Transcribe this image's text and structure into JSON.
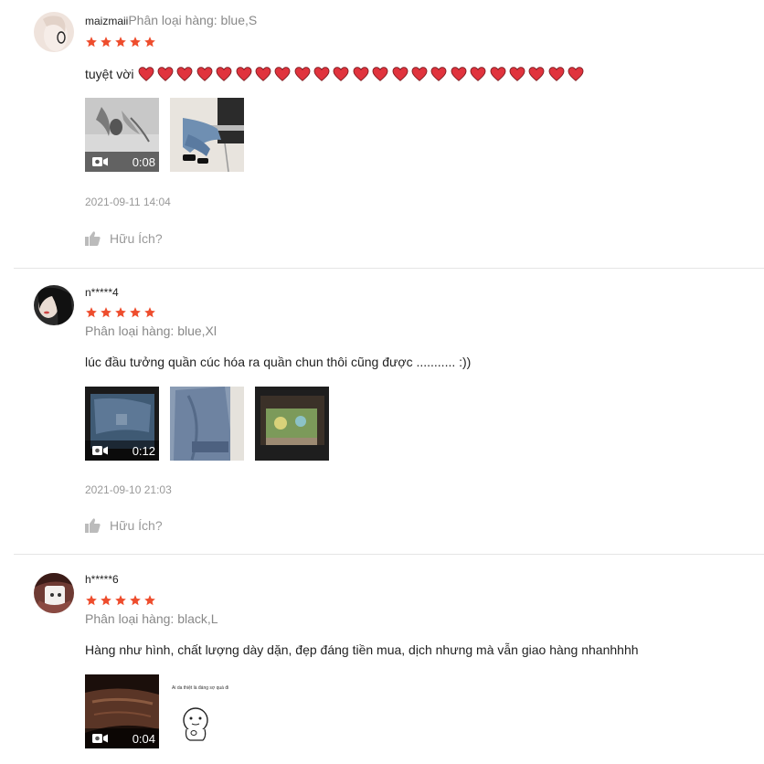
{
  "colors": {
    "star": "#ee4d2d",
    "heart": "#e0333d",
    "muted": "#999999",
    "text": "#222222"
  },
  "reviews": [
    {
      "username": "maizmaii",
      "variation_label": "Phân loại hàng: blue,S",
      "rating": 5,
      "comment": "tuyệt vời",
      "heart_count": 23,
      "media": [
        {
          "type": "video",
          "duration": "0:08"
        },
        {
          "type": "image"
        }
      ],
      "date": "2021-09-11 14:04",
      "helpful_label": "Hữu Ích?"
    },
    {
      "username": "n*****4",
      "variation_label": "Phân loại hàng: blue,Xl",
      "rating": 5,
      "comment": "lúc đầu tưởng quần cúc hóa ra quần chun thôi cũng được ........... :))",
      "media": [
        {
          "type": "video",
          "duration": "0:12"
        },
        {
          "type": "image"
        },
        {
          "type": "image"
        }
      ],
      "date": "2021-09-10 21:03",
      "helpful_label": "Hữu Ích?"
    },
    {
      "username": "h*****6",
      "variation_label": "Phân loại hàng: black,L",
      "rating": 5,
      "comment": "Hàng như hình, chất lượng dày dặn, đẹp đáng tiền mua, dịch nhưng mà vẫn giao hàng nhanhhhh",
      "media": [
        {
          "type": "video",
          "duration": "0:04"
        },
        {
          "type": "image",
          "caption": "Ái da thiệt là đáng sợ quá đi"
        }
      ]
    }
  ]
}
